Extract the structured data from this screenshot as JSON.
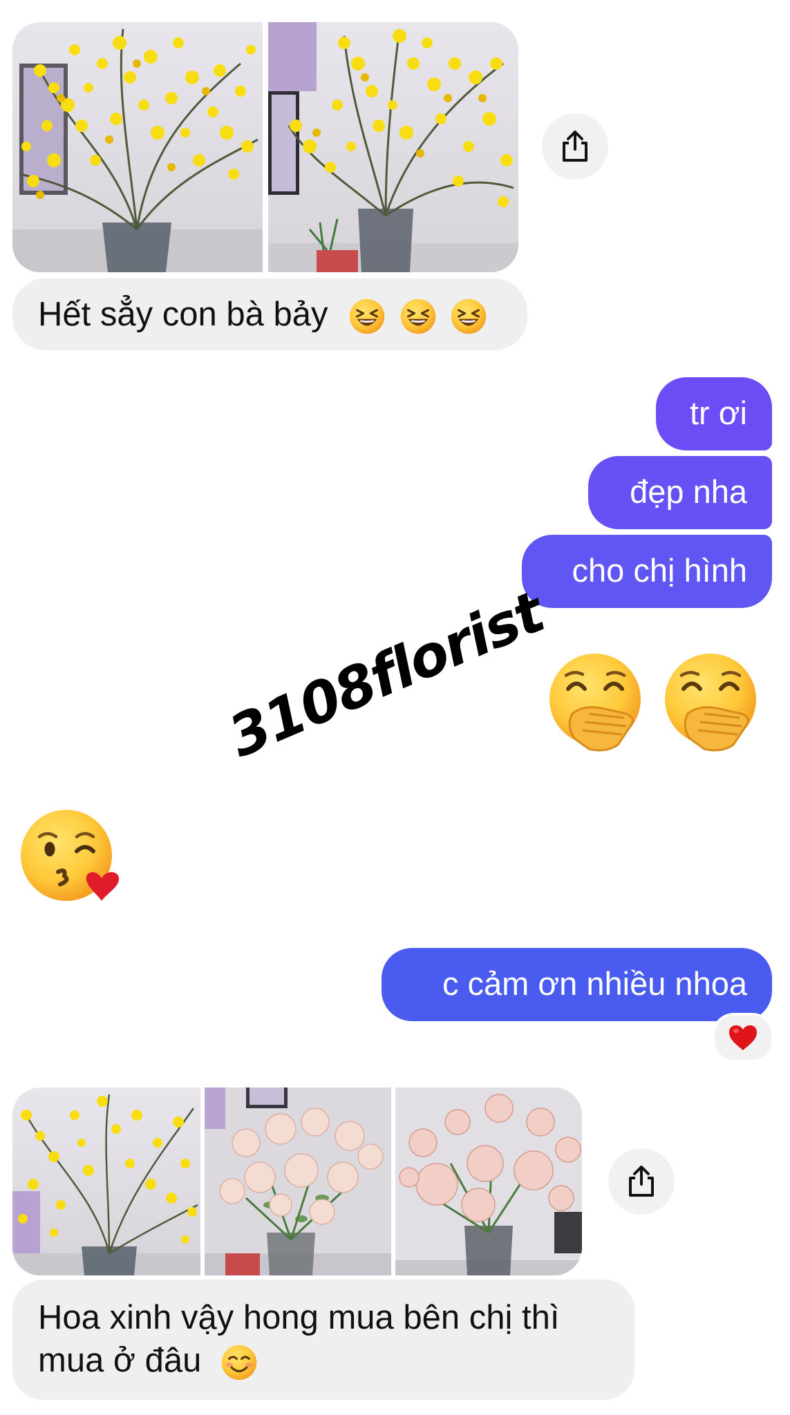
{
  "colors": {
    "incoming_bubble": "#efefef",
    "outgoing_purple": "#6b4cf5",
    "outgoing_blue": "#4a5cf0",
    "reaction_heart": "#e0151a"
  },
  "messages": {
    "m1_text": "Hết sẳy con bà bảy",
    "m1_emojis": [
      "laughing-face",
      "laughing-face",
      "laughing-face"
    ],
    "m2": "tr ơi",
    "m3": "đẹp nha",
    "m4": "cho chị hình",
    "m5_emojis": [
      "face-with-hand-over-mouth",
      "face-with-hand-over-mouth"
    ],
    "m6_emoji": "face-blowing-a-kiss",
    "m7": "c cảm ơn nhiều nhoa",
    "m7_reaction": "red-heart",
    "m8_line1": "Hoa xinh vậy hong mua bên chị thì",
    "m8_line2": "mua ở đâu",
    "m8_emoji": "smiling-face"
  },
  "photos": {
    "group1": [
      "yellow-orchid-vase",
      "yellow-orchid-vase"
    ],
    "group2": [
      "yellow-orchid-vase",
      "pink-rose-vase",
      "pink-rose-vase"
    ]
  },
  "watermark": "3108florist"
}
